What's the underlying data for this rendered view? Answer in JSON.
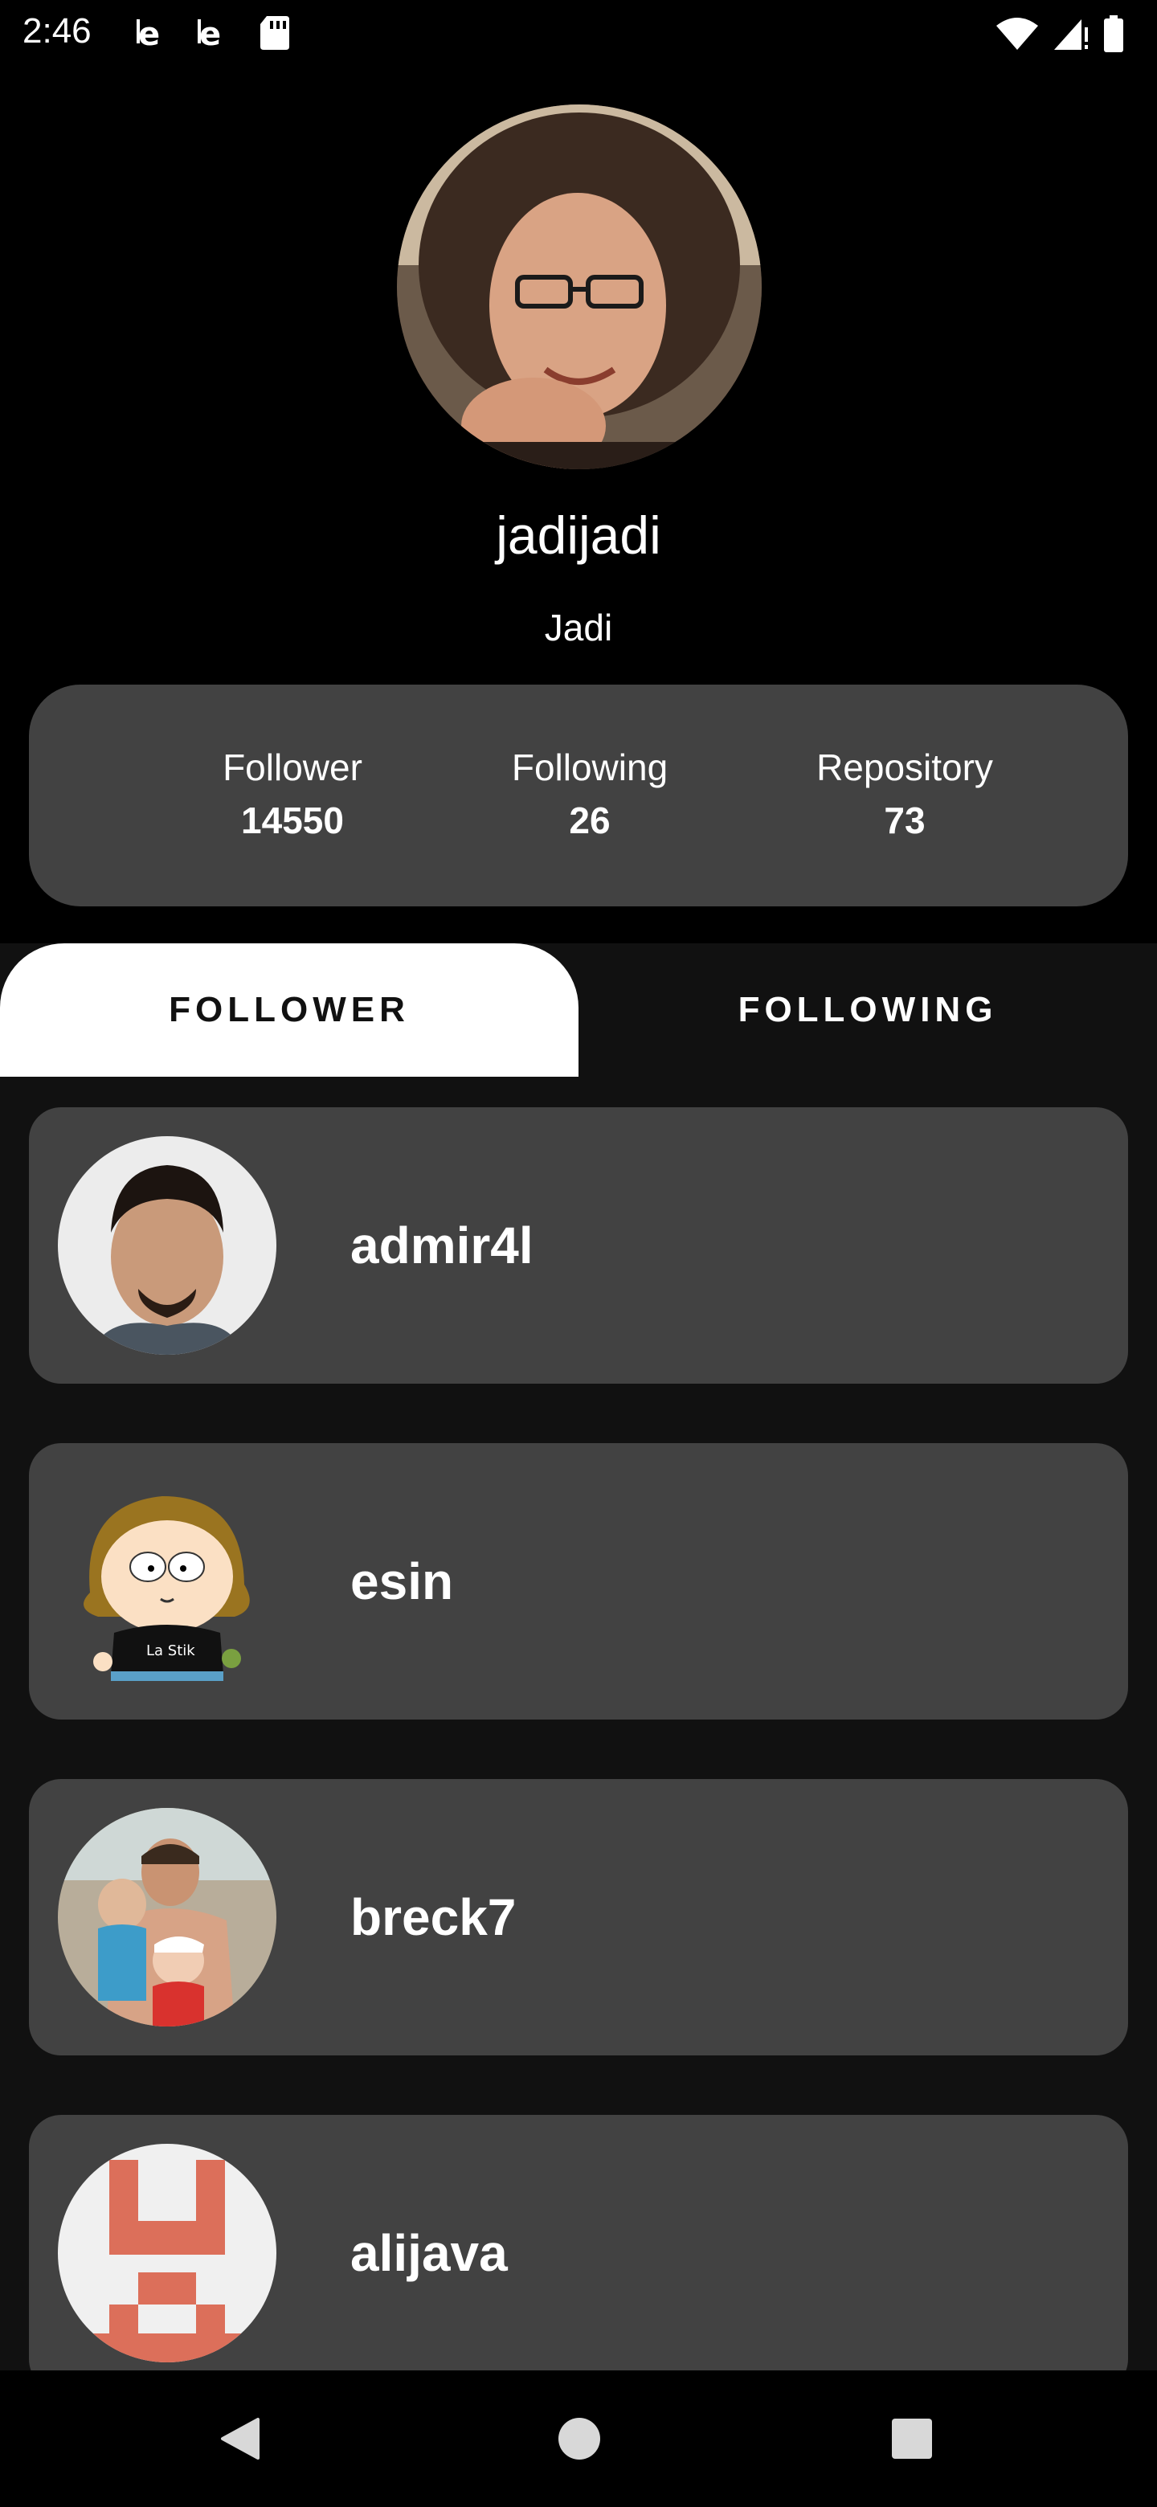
{
  "status_bar": {
    "time": "2:46",
    "icons": [
      "notification-e-icon",
      "notification-e-icon",
      "sd-card-icon",
      "wifi-icon",
      "signal-icon",
      "battery-icon"
    ]
  },
  "profile": {
    "avatar_icon": "profile-photo",
    "username": "jadijadi",
    "name": "Jadi"
  },
  "stats": [
    {
      "label": "Follower",
      "value": "14550"
    },
    {
      "label": "Following",
      "value": "26"
    },
    {
      "label": "Repository",
      "value": "73"
    }
  ],
  "tabs": [
    {
      "label": "FOLLOWER",
      "active": true
    },
    {
      "label": "FOLLOWING",
      "active": false
    }
  ],
  "users": [
    {
      "name": "admir4l",
      "avatar": "photo-avatar"
    },
    {
      "name": "esin",
      "avatar": "cartoon-avatar"
    },
    {
      "name": "breck7",
      "avatar": "family-photo-avatar"
    },
    {
      "name": "alijava",
      "avatar": "identicon-avatar"
    }
  ],
  "nav": [
    "back-icon",
    "home-icon",
    "recents-icon"
  ],
  "colors": {
    "background": "#000000",
    "card": "#424242",
    "tabs_bg": "#111111",
    "active_tab": "#ffffff",
    "identicon": "#dc6f5a"
  }
}
